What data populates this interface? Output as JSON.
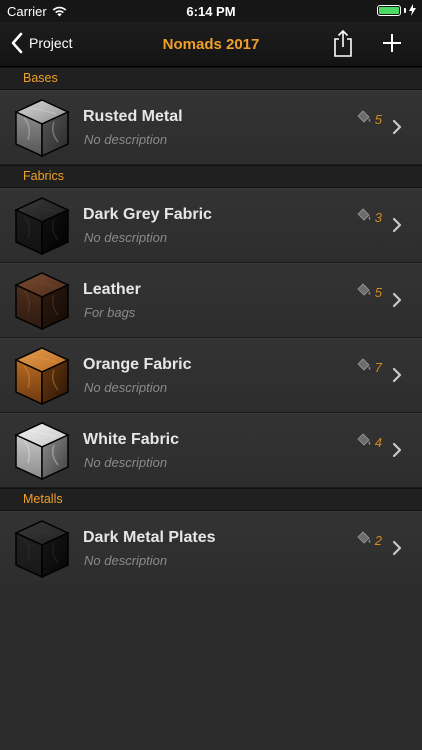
{
  "status": {
    "carrier": "Carrier",
    "time": "6:14 PM"
  },
  "nav": {
    "back_label": "Project",
    "title": "Nomads 2017"
  },
  "sections": [
    {
      "header": "Bases",
      "items": [
        {
          "name": "Rusted Metal",
          "description": "No description",
          "count": "5",
          "texture": "rusted-metal"
        }
      ]
    },
    {
      "header": "Fabrics",
      "items": [
        {
          "name": "Dark Grey Fabric",
          "description": "No description",
          "count": "3",
          "texture": "dark-fabric"
        },
        {
          "name": "Leather",
          "description": "For bags",
          "count": "5",
          "texture": "leather"
        },
        {
          "name": "Orange Fabric",
          "description": "No description",
          "count": "7",
          "texture": "orange-fabric"
        },
        {
          "name": "White Fabric",
          "description": "No description",
          "count": "4",
          "texture": "white-fabric"
        }
      ]
    },
    {
      "header": "Metalls",
      "items": [
        {
          "name": "Dark Metal Plates",
          "description": "No description",
          "count": "2",
          "texture": "dark-metal"
        }
      ]
    }
  ],
  "colors": {
    "accent": "#f0a028",
    "count": "#d4891f",
    "battery": "#4cd964"
  },
  "icons": {
    "back": "chevron-left-icon",
    "share": "share-icon",
    "add": "plus-icon",
    "paint": "paint-bucket-icon",
    "disclosure": "chevron-right-icon"
  }
}
